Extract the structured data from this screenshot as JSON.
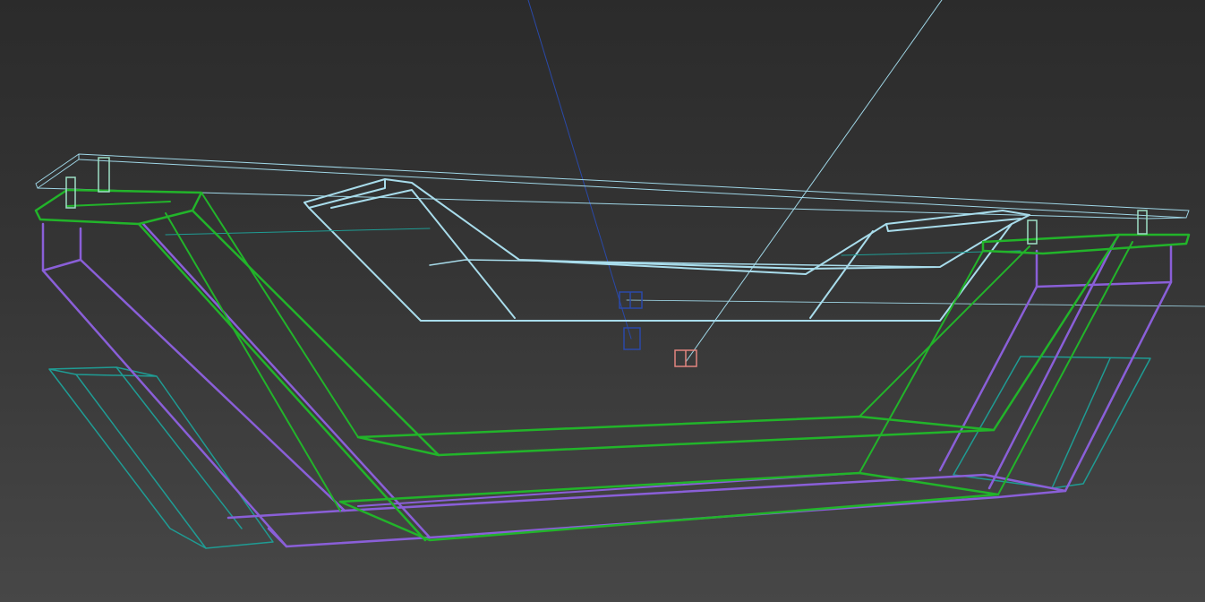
{
  "viewport": {
    "background_top": "#2b2b2b",
    "background_bottom": "#474747"
  },
  "palette": {
    "frame_green": "#22b42a",
    "frame_purple": "#8a5fd8",
    "teal_panel": "#1f9c94",
    "light_cyan": "#a8dceb",
    "top_plane": "#9fd6e6",
    "camera_blue": "#2a49a8",
    "light_pink": "#e3857f",
    "helper_mint": "#9ee0c6"
  },
  "objects": [
    {
      "name": "top-plane-wireframe",
      "color": "top_plane"
    },
    {
      "name": "inner-tray-wireframe",
      "color": "light_cyan"
    },
    {
      "name": "green-frame-wireframe",
      "color": "frame_green"
    },
    {
      "name": "purple-frame-wireframe",
      "color": "frame_purple"
    },
    {
      "name": "teal-panel-wireframe",
      "color": "teal_panel"
    },
    {
      "name": "camera-icon",
      "color": "camera_blue"
    },
    {
      "name": "light-icon",
      "color": "light_pink"
    }
  ]
}
